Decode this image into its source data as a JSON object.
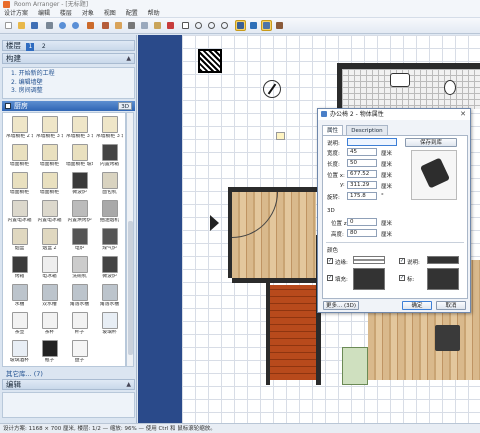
{
  "app": {
    "title": "Room Arranger - [无标题]"
  },
  "menu": [
    "设计方案",
    "编辑",
    "楼层",
    "对象",
    "视图",
    "配置",
    "帮助"
  ],
  "left": {
    "levels_label": "楼层",
    "levels": [
      "1",
      "2"
    ],
    "build_header": "构建",
    "build_steps": [
      "1. 开始新的工程",
      "2. 编辑墙壁",
      "3. 房间调整"
    ],
    "category": {
      "name": "厨房",
      "badge": "3D"
    },
    "catalog": [
      {
        "label": "吊墙橱柜 2 玻璃门",
        "color": "#efe6c8"
      },
      {
        "label": "吊墙橱柜 3 玻璃",
        "color": "#efe6c8"
      },
      {
        "label": "吊墙橱柜 3 玻璃门",
        "color": "#efe6c8"
      },
      {
        "label": "吊墙橱柜 3 玻璃门",
        "color": "#efe6c8"
      },
      {
        "label": "墙面橱柜",
        "color": "#e9e0bf"
      },
      {
        "label": "墙面橱柜",
        "color": "#e9e0bf"
      },
      {
        "label": "墙面橱柜 玻璃门",
        "color": "#e9e0bf"
      },
      {
        "label": "内置烤箱",
        "color": "#444444"
      },
      {
        "label": "墙面橱柜",
        "color": "#e9e0bf"
      },
      {
        "label": "墙面橱柜",
        "color": "#e9e0bf"
      },
      {
        "label": "微波炉",
        "color": "#3a3a3a"
      },
      {
        "label": "面包机",
        "color": "#d9d3c0"
      },
      {
        "label": "内置电冰箱",
        "color": "#dcd8cc"
      },
      {
        "label": "内置电冰箱",
        "color": "#dcd8cc"
      },
      {
        "label": "内置烘烤炉",
        "color": "#bbbbbb"
      },
      {
        "label": "抽油烟机",
        "color": "#a9a9a9"
      },
      {
        "label": "烟盒",
        "color": "#e0d8c0"
      },
      {
        "label": "烟盒 2",
        "color": "#e0d8c0"
      },
      {
        "label": "电炉",
        "color": "#555555"
      },
      {
        "label": "煤气炉",
        "color": "#555555"
      },
      {
        "label": "烤箱",
        "color": "#3b3b3b"
      },
      {
        "label": "电冰箱",
        "color": "#eeeeee"
      },
      {
        "label": "洗碗机",
        "color": "#cccccc"
      },
      {
        "label": "微波炉",
        "color": "#444444"
      },
      {
        "label": "水槽",
        "color": "#bcc4cc"
      },
      {
        "label": "双水槽",
        "color": "#bcc4cc"
      },
      {
        "label": "角落水槽",
        "color": "#bcc4cc"
      },
      {
        "label": "角落水槽",
        "color": "#bcc4cc"
      },
      {
        "label": "茶壶",
        "color": "#f2f2f2"
      },
      {
        "label": "茶杯",
        "color": "#f2f2f2"
      },
      {
        "label": "杯子",
        "color": "#f2f2f2"
      },
      {
        "label": "玻璃杯",
        "color": "#e8eef5"
      },
      {
        "label": "玻璃酒杯",
        "color": "#e8eef5"
      },
      {
        "label": "瓶子",
        "color": "#222222"
      },
      {
        "label": "盘子",
        "color": "#f5f5f5"
      }
    ],
    "more_link": "其它库... (7)",
    "edit_header": "编辑"
  },
  "dialog": {
    "title": "办公椅 2 - 物体属性",
    "tabs": [
      "属性",
      "Description"
    ],
    "fields": {
      "desc_label": "说明:",
      "desc_value": "",
      "width_label": "宽度:",
      "width_value": "45",
      "length_label": "长度:",
      "length_value": "50",
      "pos_label": "位置 x:",
      "posx_value": "677.52",
      "posy_label": "y:",
      "posy_value": "311.29",
      "rot_label": "旋转:",
      "rot_value": "175.8",
      "unit": "厘米",
      "deg_unit": "°"
    },
    "save_btn": "保存到库",
    "three_d": {
      "section": "3D",
      "pos_z_label": "位置 z:",
      "pos_z_value": "0",
      "height_label": "高度:",
      "height_value": "80",
      "unit": "厘米"
    },
    "colors": {
      "section": "颜色",
      "outline_label": "边缘:",
      "desc_label": "说明:",
      "fill_label": "填充:",
      "fill_label2": "标:",
      "outline_color": "#ffffff",
      "desc_color": "#333333",
      "fill_color": "#333333",
      "fill_color2": "#333333"
    },
    "more_btn": "更多... (3D)",
    "ok_btn": "确定",
    "cancel_btn": "取消"
  },
  "status": "设计方案: 1168 × 700 厘米, 楼层: 1/2 — 缩放: 96% — 使用 Ctrl 和 鼠标滚轮缩放。"
}
